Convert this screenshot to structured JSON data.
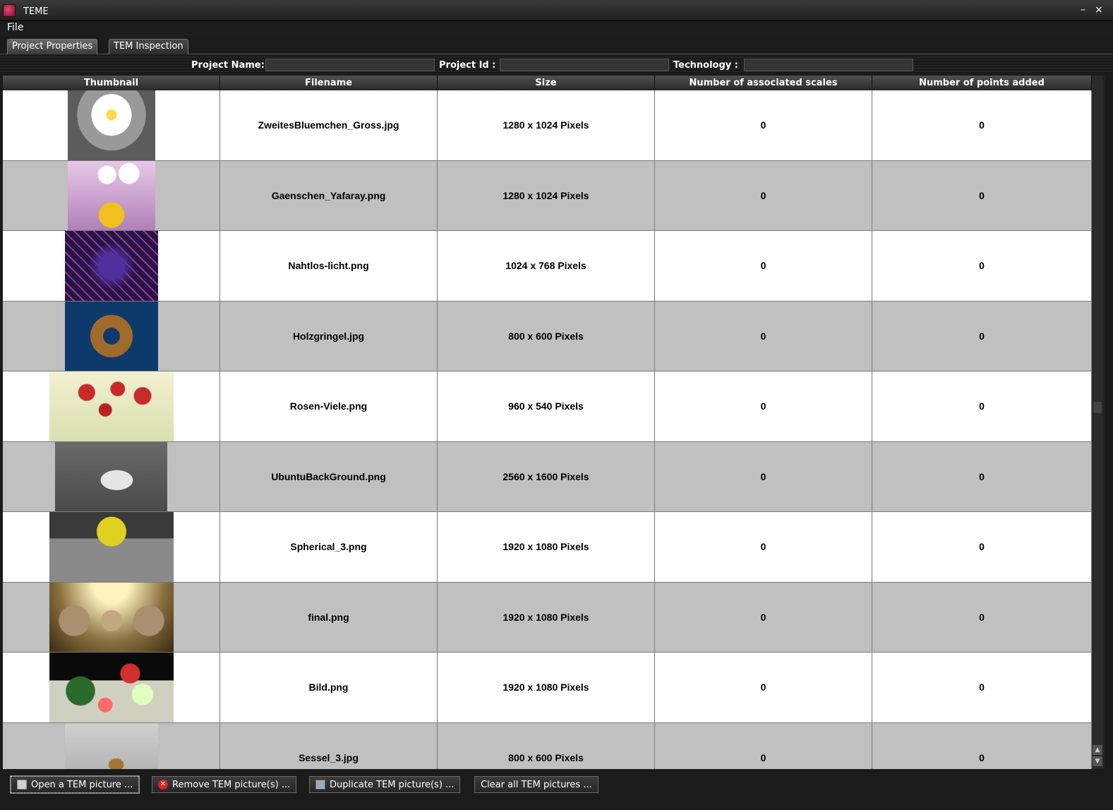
{
  "window": {
    "title": "TEME",
    "minimize_glyph": "–",
    "close_glyph": "×"
  },
  "menu": {
    "file": "File"
  },
  "tabs": [
    {
      "label": "Project Properties",
      "active": true
    },
    {
      "label": "TEM Inspection",
      "active": false
    }
  ],
  "properties": {
    "project_name_label": "Project Name:",
    "project_name_value": "",
    "project_id_label": "Project Id  :",
    "project_id_value": "",
    "technology_label": "Technology  :",
    "technology_value": ""
  },
  "table": {
    "columns": [
      "Thumbnail",
      "Filename",
      "Size",
      "Number of associated scales",
      "Number of points added"
    ],
    "rows": [
      {
        "thumbnail": "daisy-render",
        "filename": "ZweitesBluemchen_Gross.jpg",
        "size": "1280 x 1024 Pixels",
        "scales": "0",
        "points": "0"
      },
      {
        "thumbnail": "flowers-vase-render",
        "filename": "Gaenschen_Yafaray.png",
        "size": "1280 x 1024 Pixels",
        "scales": "0",
        "points": "0"
      },
      {
        "thumbnail": "purple-pattern-render",
        "filename": "Nahtlos-licht.png",
        "size": "1024 x 768 Pixels",
        "scales": "0",
        "points": "0"
      },
      {
        "thumbnail": "wooden-ring-render",
        "filename": "Holzgringel.jpg",
        "size": "800 x 600 Pixels",
        "scales": "0",
        "points": "0"
      },
      {
        "thumbnail": "roses-render",
        "filename": "Rosen-Viele.png",
        "size": "960 x 540 Pixels",
        "scales": "0",
        "points": "0"
      },
      {
        "thumbnail": "lego-brick-render",
        "filename": "UbuntuBackGround.png",
        "size": "2560 x 1600 Pixels",
        "scales": "0",
        "points": "0"
      },
      {
        "thumbnail": "sphere-render",
        "filename": "Spherical_3.png",
        "size": "1920 x 1080 Pixels",
        "scales": "0",
        "points": "0"
      },
      {
        "thumbnail": "glass-spheres-render",
        "filename": "final.png",
        "size": "1920 x 1080 Pixels",
        "scales": "0",
        "points": "0"
      },
      {
        "thumbnail": "marbles-render",
        "filename": "Bild.png",
        "size": "1920 x 1080 Pixels",
        "scales": "0",
        "points": "0"
      },
      {
        "thumbnail": "chair-render",
        "filename": "Sessel_3.jpg",
        "size": "800 x 600 Pixels",
        "scales": "0",
        "points": "0"
      }
    ]
  },
  "actions": {
    "open": "Open a TEM picture ...",
    "remove": "Remove TEM picture(s) ...",
    "duplicate": "Duplicate TEM picture(s) ...",
    "clear": "Clear all TEM pictures ..."
  },
  "colors": {
    "row_odd": "#ffffff",
    "row_even": "#c0c0c0",
    "chrome": "#1b1b1b"
  }
}
